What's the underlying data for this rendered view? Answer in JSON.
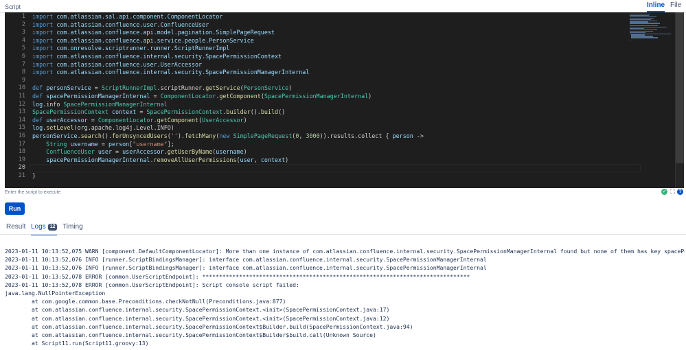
{
  "header": {
    "section_label": "Script",
    "mode_tabs": [
      {
        "label": "Inline",
        "active": true
      },
      {
        "label": "File",
        "active": false
      }
    ]
  },
  "editor": {
    "line_numbers": [
      "1",
      "2",
      "3",
      "4",
      "5",
      "6",
      "7",
      "8",
      "9",
      "10",
      "11",
      "12",
      "13",
      "14",
      "15",
      "16",
      "17",
      "18",
      "19",
      "20",
      "21"
    ],
    "current_line": 20,
    "lines": [
      "import com.atlassian.sal.api.component.ComponentLocator",
      "import com.atlassian.confluence.user.ConfluenceUser",
      "import com.atlassian.confluence.api.model.pagination.SimplePageRequest",
      "import com.atlassian.confluence.api.service.people.PersonService",
      "import com.onresolve.scriptrunner.runner.ScriptRunnerImpl",
      "import com.atlassian.confluence.internal.security.SpacePermissionContext",
      "import com.atlassian.confluence.user.UserAccessor",
      "import com.atlassian.confluence.internal.security.SpacePermissionManagerInternal",
      "",
      "def personService = ScriptRunnerImpl.scriptRunner.getService(PersonService)",
      "def spacePermissionManagerInternal = ComponentLocator.getComponent(SpacePermissionManagerInternal)",
      "log.info SpacePermissionManagerInternal",
      "SpacePermissionContext context = SpacePermissionContext.builder().build()",
      "def userAccessor = ComponentLocator.getComponent(UserAccessor)",
      "log.setLevel(org.apache.log4j.Level.INFO)",
      "personService.search().forUnsyncedUsers('').fetchMany(new SimplePageRequest(0, 3000)).results.collect { person ->",
      "    String username = person[\"username\"];",
      "    ConfluenceUser user = userAccessor.getUserByName(username)",
      "    spacePermissionManagerInternal.removeAllUserPermissions(user, context)",
      "",
      "}"
    ],
    "hint": "Enter the script to execute",
    "status_icons": [
      "check-icon",
      "expand-icon",
      "help-icon"
    ]
  },
  "actions": {
    "run_label": "Run"
  },
  "result_tabs": [
    {
      "label": "Result",
      "active": false
    },
    {
      "label": "Logs",
      "badge": "12",
      "active": true
    },
    {
      "label": "Timing",
      "active": false
    }
  ],
  "log_lines": [
    "2023-01-11 10:13:52,075 WARN [component.DefaultComponentLocator]: More than one instance of com.atlassian.confluence.internal.security.SpacePermissionManagerInternal found but none of them has key spacePermissi",
    "2023-01-11 10:13:52,076 INFO [runner.ScriptBindingsManager]: interface com.atlassian.confluence.internal.security.SpacePermissionManagerInternal",
    "2023-01-11 10:13:52,076 INFO [runner.ScriptBindingsManager]: interface com.atlassian.confluence.internal.security.SpacePermissionManagerInternal",
    "2023-01-11 10:13:52,078 ERROR [common.UserScriptEndpoint]: ********************************************************************************",
    "2023-01-11 10:13:52,078 ERROR [common.UserScriptEndpoint]: Script console script failed:",
    "java.lang.NullPointerException",
    "        at com.google.common.base.Preconditions.checkNotNull(Preconditions.java:877)",
    "        at com.atlassian.confluence.internal.security.SpacePermissionContext.<init>(SpacePermissionContext.java:17)",
    "        at com.atlassian.confluence.internal.security.SpacePermissionContext.<init>(SpacePermissionContext.java:12)",
    "        at com.atlassian.confluence.internal.security.SpacePermissionContext$Builder.build(SpacePermissionContext.java:94)",
    "        at com.atlassian.confluence.internal.security.SpacePermissionContext$Builder$build.call(Unknown Source)",
    "        at Script11.run(Script11.groovy:13)"
  ]
}
